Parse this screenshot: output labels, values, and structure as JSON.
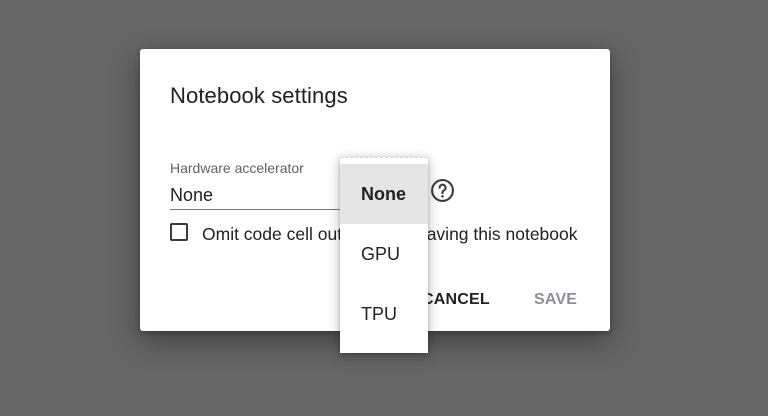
{
  "dialog": {
    "title": "Notebook settings",
    "hardware_label": "Hardware accelerator",
    "hardware_value": "None",
    "omit_checkbox_label": "Omit code cell output when saving this notebook",
    "omit_checked": false,
    "cancel_label": "CANCEL",
    "save_label": "SAVE",
    "help_icon": "help-circle-icon"
  },
  "dropdown": {
    "selected": "None",
    "options": [
      {
        "label": "None"
      },
      {
        "label": "GPU"
      },
      {
        "label": "TPU"
      }
    ]
  },
  "colors": {
    "backdrop": "#656565",
    "dialog_bg": "#ffffff",
    "selected_option_bg": "#e5e5e5",
    "disabled_button": "#8a8f99"
  }
}
